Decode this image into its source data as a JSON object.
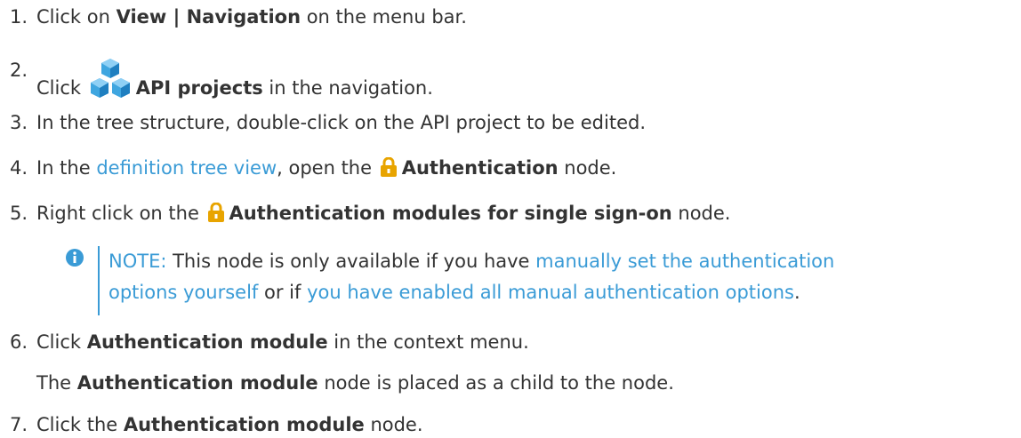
{
  "steps": [
    {
      "number": "1.",
      "pre": "Click on ",
      "bold": "View | Navigation",
      "post": " on the menu bar."
    },
    {
      "number": "2.",
      "pre": "Click ",
      "icon": "api-projects-cubes-icon",
      "bold": "API projects",
      "post": " in the navigation."
    },
    {
      "number": "3.",
      "text": "In the tree structure, double-click on the API project to be edited."
    },
    {
      "number": "4.",
      "pre": "In the ",
      "link": "definition tree view",
      "mid": ", open the ",
      "icon": "lock-icon",
      "bold": "Authentication",
      "post": " node."
    },
    {
      "number": "5.",
      "pre": "Right click on the ",
      "icon": "lock-icon",
      "bold": "Authentication modules for single sign-on",
      "post": " node."
    },
    {
      "number": "6.",
      "pre": "Click ",
      "bold": "Authentication module",
      "post": " in the context menu."
    },
    {
      "number": "7.",
      "pre": "Click the ",
      "bold": "Authentication module",
      "post": " node."
    }
  ],
  "step6_followup": {
    "pre": "The ",
    "bold": "Authentication module",
    "post": " node is placed as a child to the node."
  },
  "note": {
    "icon": "info-icon",
    "label": "NOTE:",
    "line1_text": " This node is only available if you have ",
    "link1_part1": "manually set the authentication",
    "link1_part2": "options yourself",
    "or_text": " or if ",
    "link2": "you have enabled all manual authentication options",
    "end": "."
  },
  "colors": {
    "link": "#3a9bd6",
    "text": "#333333",
    "lock": "#e8a400",
    "cubes": "#3fa6e0"
  }
}
